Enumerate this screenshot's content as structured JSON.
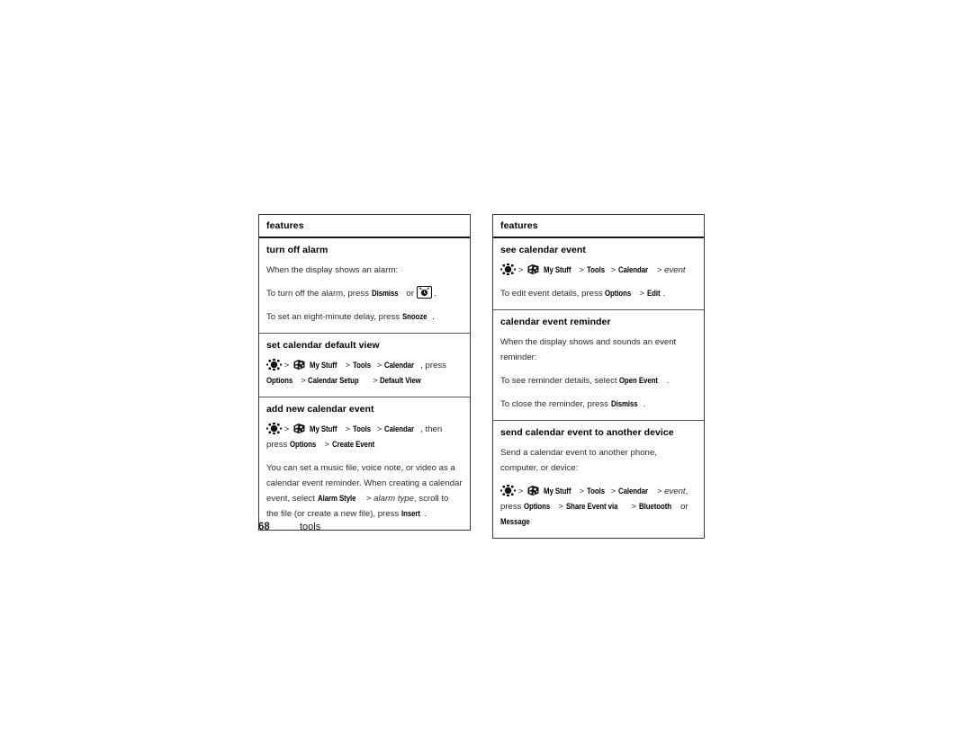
{
  "page": {
    "number": "68",
    "section": "tools"
  },
  "tables": [
    {
      "id": "left",
      "header": "features",
      "rows": [
        {
          "title": "turn off alarm",
          "blocks": [
            {
              "type": "text",
              "parts": [
                {
                  "t": "plain",
                  "v": "When the display shows an alarm:"
                }
              ]
            },
            {
              "type": "text",
              "parts": [
                {
                  "t": "plain",
                  "v": "To turn off the alarm, press "
                },
                {
                  "t": "key",
                  "v": "Dismiss"
                },
                {
                  "t": "plain",
                  "v": " or "
                },
                {
                  "t": "icon",
                  "v": "alarm-key-icon"
                },
                {
                  "t": "plain",
                  "v": "."
                }
              ]
            },
            {
              "type": "text",
              "parts": [
                {
                  "t": "plain",
                  "v": "To set an eight-minute delay, press "
                },
                {
                  "t": "key",
                  "v": "Snooze"
                },
                {
                  "t": "plain",
                  "v": "."
                }
              ]
            }
          ]
        },
        {
          "title": "set calendar default view",
          "blocks": [
            {
              "type": "path",
              "parts": [
                {
                  "t": "icon",
                  "v": "nav-key-icon"
                },
                {
                  "t": "sep",
                  "v": " > "
                },
                {
                  "t": "icon",
                  "v": "my-stuff-icon"
                },
                {
                  "t": "key",
                  "v": "My Stuff"
                },
                {
                  "t": "sep",
                  "v": " > "
                },
                {
                  "t": "key",
                  "v": "Tools"
                },
                {
                  "t": "sep",
                  "v": " > "
                },
                {
                  "t": "key",
                  "v": "Calendar"
                },
                {
                  "t": "plain",
                  "v": ", press "
                },
                {
                  "t": "key",
                  "v": "Options"
                },
                {
                  "t": "sep",
                  "v": " > "
                },
                {
                  "t": "key",
                  "v": "Calendar Setup"
                },
                {
                  "t": "sep",
                  "v": " > "
                },
                {
                  "t": "key",
                  "v": "Default View"
                }
              ]
            }
          ]
        },
        {
          "title": "add new calendar event",
          "blocks": [
            {
              "type": "path",
              "parts": [
                {
                  "t": "icon",
                  "v": "nav-key-icon"
                },
                {
                  "t": "sep",
                  "v": " > "
                },
                {
                  "t": "icon",
                  "v": "my-stuff-icon"
                },
                {
                  "t": "key",
                  "v": "My Stuff"
                },
                {
                  "t": "sep",
                  "v": " > "
                },
                {
                  "t": "key",
                  "v": "Tools"
                },
                {
                  "t": "sep",
                  "v": " > "
                },
                {
                  "t": "key",
                  "v": "Calendar"
                },
                {
                  "t": "plain",
                  "v": ", then press "
                },
                {
                  "t": "key",
                  "v": "Options"
                },
                {
                  "t": "sep",
                  "v": " > "
                },
                {
                  "t": "key",
                  "v": "Create Event"
                }
              ]
            },
            {
              "type": "text",
              "parts": [
                {
                  "t": "plain",
                  "v": "You can set a music file, voice note, or video as a calendar event reminder. When creating a calendar event, select "
                },
                {
                  "t": "key",
                  "v": "Alarm Style"
                },
                {
                  "t": "sep",
                  "v": " > "
                },
                {
                  "t": "italic",
                  "v": "alarm type"
                },
                {
                  "t": "plain",
                  "v": ", scroll to the file (or create a new file), press "
                },
                {
                  "t": "key",
                  "v": "Insert"
                },
                {
                  "t": "plain",
                  "v": "."
                }
              ]
            }
          ]
        }
      ]
    },
    {
      "id": "right",
      "header": "features",
      "rows": [
        {
          "title": "see calendar event",
          "blocks": [
            {
              "type": "path",
              "parts": [
                {
                  "t": "icon",
                  "v": "nav-key-icon"
                },
                {
                  "t": "sep",
                  "v": " > "
                },
                {
                  "t": "icon",
                  "v": "my-stuff-icon"
                },
                {
                  "t": "key",
                  "v": "My Stuff"
                },
                {
                  "t": "sep",
                  "v": " > "
                },
                {
                  "t": "key",
                  "v": "Tools"
                },
                {
                  "t": "sep",
                  "v": " > "
                },
                {
                  "t": "key",
                  "v": "Calendar"
                },
                {
                  "t": "sep",
                  "v": " > "
                },
                {
                  "t": "italic",
                  "v": "event"
                }
              ]
            },
            {
              "type": "text",
              "parts": [
                {
                  "t": "plain",
                  "v": "To edit event details, press "
                },
                {
                  "t": "key",
                  "v": "Options"
                },
                {
                  "t": "sep",
                  "v": " > "
                },
                {
                  "t": "key",
                  "v": "Edit"
                },
                {
                  "t": "plain",
                  "v": "."
                }
              ]
            }
          ]
        },
        {
          "title": "calendar event reminder",
          "blocks": [
            {
              "type": "text",
              "parts": [
                {
                  "t": "plain",
                  "v": "When the display shows and sounds an event reminder:"
                }
              ]
            },
            {
              "type": "text",
              "parts": [
                {
                  "t": "plain",
                  "v": "To see reminder details, select "
                },
                {
                  "t": "key",
                  "v": "Open Event"
                },
                {
                  "t": "plain",
                  "v": "."
                }
              ]
            },
            {
              "type": "text",
              "parts": [
                {
                  "t": "plain",
                  "v": "To close the reminder, press "
                },
                {
                  "t": "key",
                  "v": "Dismiss"
                },
                {
                  "t": "plain",
                  "v": "."
                }
              ]
            }
          ]
        },
        {
          "title": "send calendar event to another device",
          "blocks": [
            {
              "type": "text",
              "parts": [
                {
                  "t": "plain",
                  "v": "Send a calendar event to another phone, computer, or device:"
                }
              ]
            },
            {
              "type": "path",
              "parts": [
                {
                  "t": "icon",
                  "v": "nav-key-icon"
                },
                {
                  "t": "sep",
                  "v": " > "
                },
                {
                  "t": "icon",
                  "v": "my-stuff-icon"
                },
                {
                  "t": "key",
                  "v": "My Stuff"
                },
                {
                  "t": "sep",
                  "v": " > "
                },
                {
                  "t": "key",
                  "v": "Tools"
                },
                {
                  "t": "sep",
                  "v": " > "
                },
                {
                  "t": "key",
                  "v": "Calendar"
                },
                {
                  "t": "sep",
                  "v": " > "
                },
                {
                  "t": "italic",
                  "v": "event"
                },
                {
                  "t": "plain",
                  "v": ", press "
                },
                {
                  "t": "key",
                  "v": "Options"
                },
                {
                  "t": "sep",
                  "v": " > "
                },
                {
                  "t": "key",
                  "v": "Share Event via"
                },
                {
                  "t": "sep",
                  "v": " > "
                },
                {
                  "t": "key",
                  "v": "Bluetooth"
                },
                {
                  "t": "plain",
                  "v": " or "
                },
                {
                  "t": "key",
                  "v": "Message"
                }
              ]
            }
          ]
        }
      ]
    }
  ],
  "icons": {
    "nav-key-icon": "nav-key-icon",
    "my-stuff-icon": "my-stuff-icon",
    "alarm-key-icon": "alarm-key-icon"
  },
  "colors": {
    "text": "#2a2a2a",
    "border": "#3a3a3a",
    "header_rule": "#1a1a1a"
  }
}
